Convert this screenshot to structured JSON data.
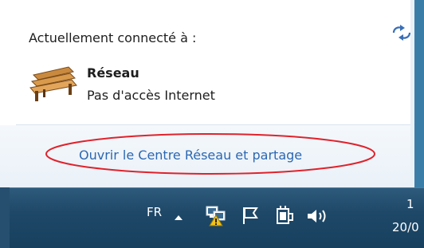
{
  "popup": {
    "connected_label": "Actuellement connecté à :",
    "network": {
      "name": "Réseau",
      "status": "Pas d'accès Internet"
    },
    "open_center_link": "Ouvrir le Centre Réseau et partage"
  },
  "taskbar": {
    "language": "FR",
    "clock_time": "1",
    "clock_date": "20/0"
  },
  "icons": {
    "refresh": "refresh-icon",
    "network": "bench-network-icon",
    "tray_chevron": "chevron-up-icon",
    "tray_network": "network-warning-icon",
    "tray_flag": "action-center-flag-icon",
    "tray_power": "power-icon",
    "tray_volume": "volume-icon"
  },
  "colors": {
    "link": "#2b68b2",
    "highlight": "#e0222b",
    "taskbar": "#1f4868"
  }
}
